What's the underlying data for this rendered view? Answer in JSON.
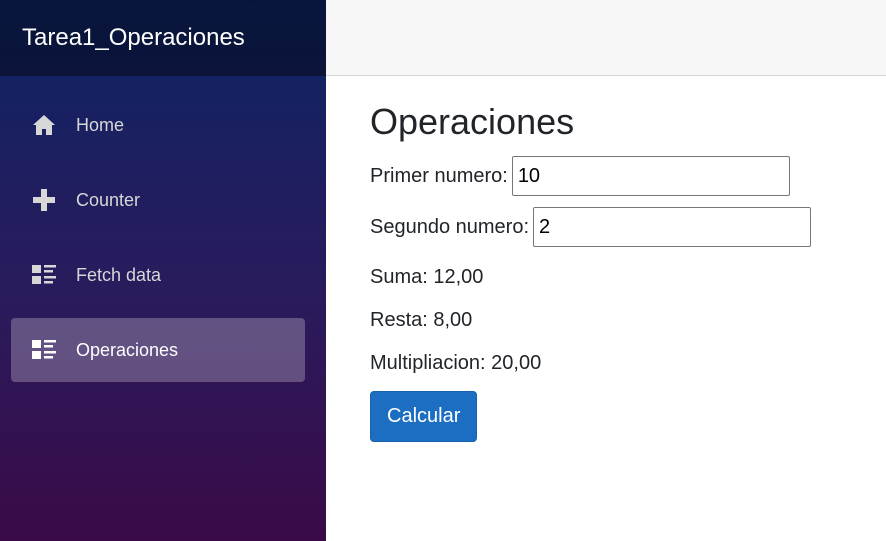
{
  "app": {
    "brand": "Tarea1_Operaciones"
  },
  "nav": {
    "items": [
      {
        "label": "Home",
        "icon": "home-icon",
        "active": false
      },
      {
        "label": "Counter",
        "icon": "plus-icon",
        "active": false
      },
      {
        "label": "Fetch data",
        "icon": "list-rich-icon",
        "active": false
      },
      {
        "label": "Operaciones",
        "icon": "list-rich-icon",
        "active": true
      }
    ]
  },
  "page": {
    "title": "Operaciones",
    "first_label": "Primer numero:",
    "first_value": "10",
    "second_label": "Segundo numero:",
    "second_value": "2",
    "suma": "Suma: 12,00",
    "resta": "Resta: 8,00",
    "multiplicacion": "Multipliacion: 20,00",
    "button_label": "Calcular"
  },
  "colors": {
    "button": "#1b6ec2",
    "sidebar_top": "#0d2464",
    "sidebar_bottom": "#3a0a48",
    "top_row": "#f7f7f7"
  }
}
